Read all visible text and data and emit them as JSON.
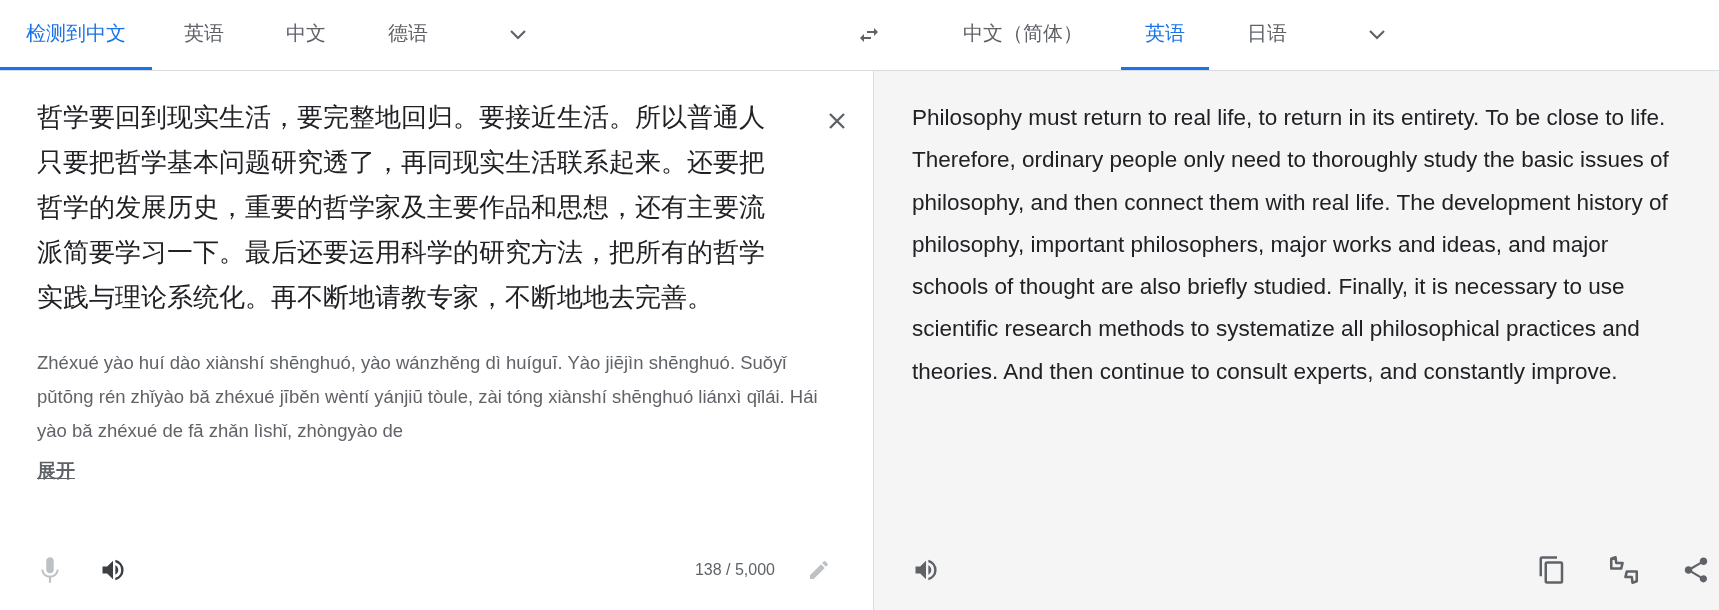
{
  "source_tabs": [
    {
      "label": "检测到中文",
      "selected": true
    },
    {
      "label": "英语",
      "selected": false
    },
    {
      "label": "中文",
      "selected": false
    },
    {
      "label": "德语",
      "selected": false
    }
  ],
  "target_tabs": [
    {
      "label": "中文（简体）",
      "selected": false
    },
    {
      "label": "英语",
      "selected": true
    },
    {
      "label": "日语",
      "selected": false
    }
  ],
  "source": {
    "text": "哲学要回到现实生活，要完整地回归。要接近生活。所以普通人只要把哲学基本问题研究透了，再同现实生活联系起来。还要把哲学的发展历史，重要的哲学家及主要作品和思想，还有主要流派简要学习一下。最后还要运用科学的研究方法，把所有的哲学实践与理论系统化。再不断地请教专家，不断地地去完善。",
    "pinyin": "Zhéxué yào huí dào xiànshí shēnghuó, yào wánzhěng dì huíguī. Yào jiējìn shēnghuó. Suǒyǐ pǔtōng rén zhǐyào bǎ zhéxué jīběn wèntí yánjiū tòule, zài tóng xiànshí shēnghuó liánxì qǐlái. Hái yào bǎ zhéxué de fā zhǎn lìshǐ, zhòngyào de",
    "expand_link": "展开",
    "char_count": "138 / 5,000"
  },
  "translation": {
    "text": "Philosophy must return to real life, to return in its entirety. To be close to life. Therefore, ordinary people only need to thoroughly study the basic issues of philosophy, and then connect them with real life. The development history of philosophy, important philosophers, major works and ideas, and major schools of thought are also briefly studied. Finally, it is necessary to use scientific research methods to systematize all philosophical practices and theories. And then continue to consult experts, and constantly improve."
  }
}
